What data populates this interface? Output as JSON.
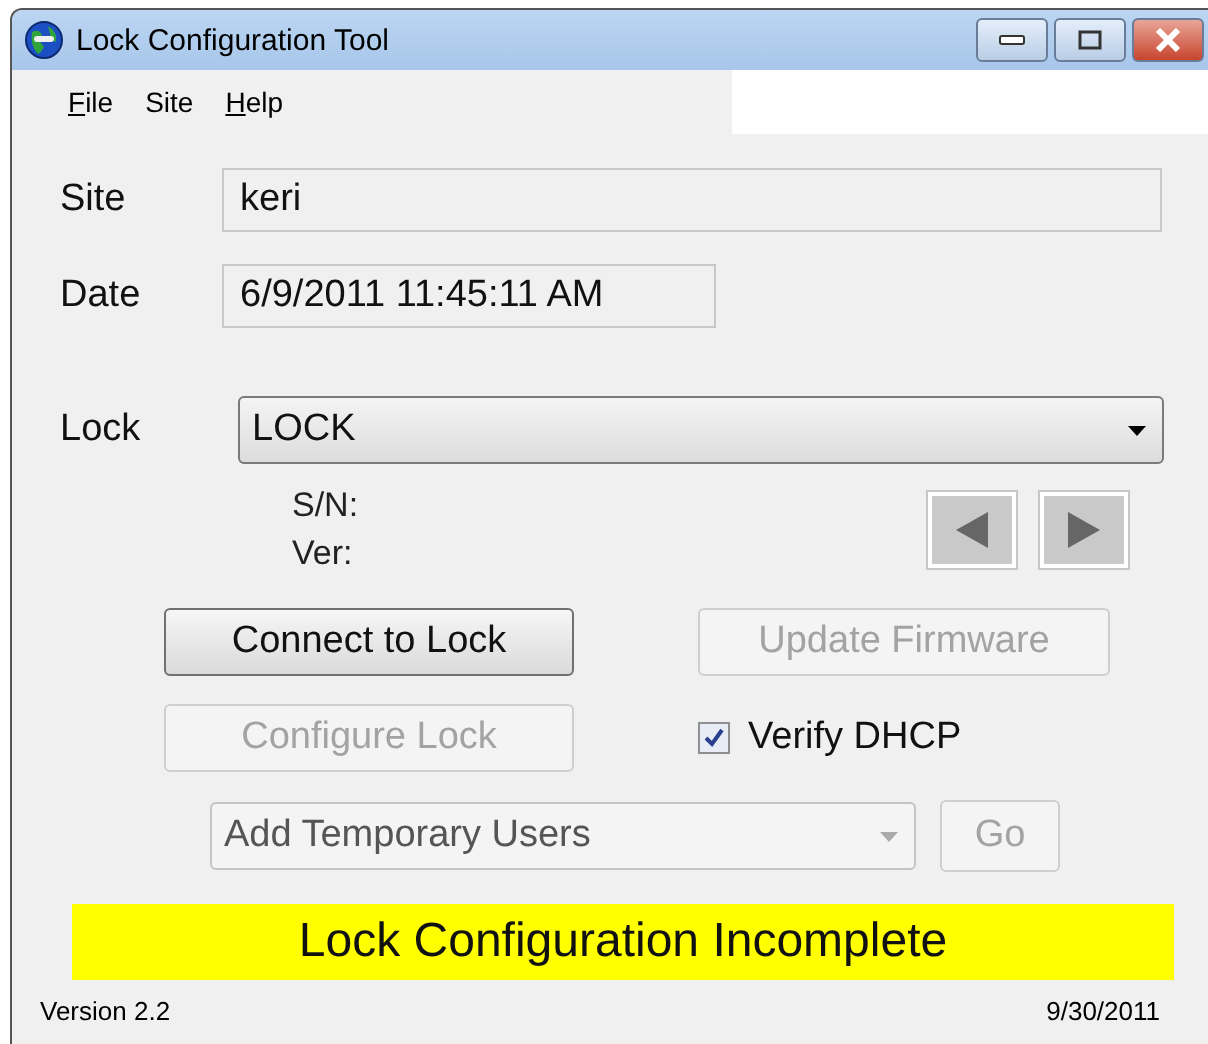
{
  "window": {
    "title": "Lock Configuration Tool"
  },
  "menu": [
    {
      "label": "File",
      "underline_first": true
    },
    {
      "label": "Site",
      "underline_first": false
    },
    {
      "label": "Help",
      "underline_first": true
    }
  ],
  "site": {
    "label": "Site",
    "value": "keri"
  },
  "date": {
    "label": "Date",
    "value": "6/9/2011 11:45:11 AM"
  },
  "lock": {
    "label": "Lock",
    "value": "LOCK"
  },
  "lock_info": {
    "serial_label": "S/N:",
    "version_label": "Ver:"
  },
  "nav_buttons": [
    {
      "kind": "previous",
      "disabled": true
    },
    {
      "kind": "next",
      "disabled": true
    }
  ],
  "connect_button": {
    "label": "Connect to Lock",
    "disabled": false
  },
  "update_button": {
    "label": "Update Firmware",
    "disabled": true
  },
  "configure_button": {
    "label": "Configure Lock",
    "disabled": true
  },
  "verify_dhcp": {
    "label": "Verify DHCP",
    "checked": true
  },
  "action": {
    "value": "Add Temporary Users",
    "disabled": true
  },
  "go_button": {
    "label": "Go",
    "disabled": true
  },
  "banner": "Lock Configuration Incomplete",
  "status_bar": {
    "version": "Version 2.2",
    "date": "9/30/2011"
  }
}
